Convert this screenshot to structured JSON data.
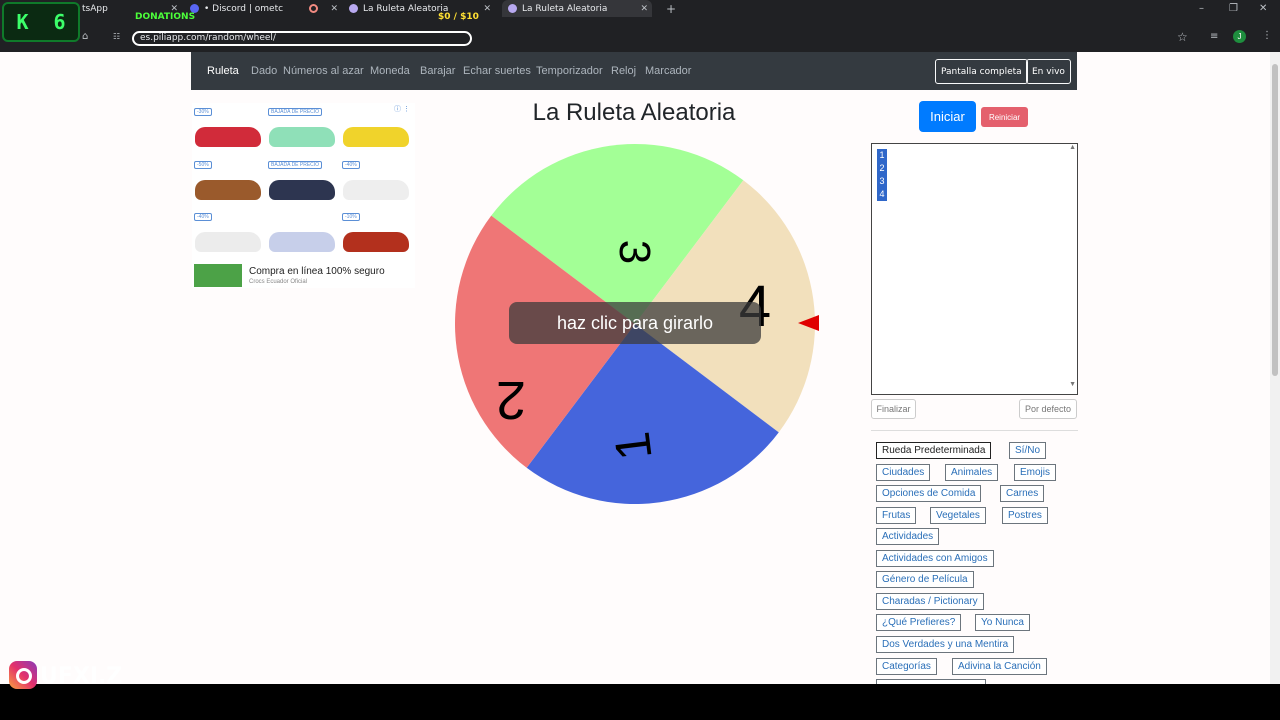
{
  "browser": {
    "tabs": [
      {
        "label": "tsApp"
      },
      {
        "label": "• Discord | ometc"
      },
      {
        "label": "La Ruleta Aleatoria"
      },
      {
        "label": "La Ruleta Aleatoria"
      }
    ],
    "url": "es.piliapp.com/random/wheel/",
    "new_tab": "+",
    "window_controls": [
      "–",
      "❐",
      "✕"
    ]
  },
  "stream_overlay": {
    "counter_letter": "K",
    "counter_value": "6",
    "donations_label": "DONATIONS",
    "money": "$0 / $10",
    "handle": "UFXI.Z"
  },
  "nav": {
    "items": [
      "Ruleta",
      "Dado",
      "Números al azar",
      "Moneda",
      "Barajar",
      "Echar suertes",
      "Temporizador",
      "Reloj",
      "Marcador"
    ],
    "fullscreen": "Pantalla completa",
    "live": "En vivo"
  },
  "ad": {
    "tags": [
      "-30%",
      "BAJADA DE PRECIO",
      "",
      "-50%",
      "BAJADA DE PRECIO",
      "-40%",
      "-40%",
      "",
      "-10%"
    ],
    "text": "Compra en línea 100% seguro",
    "sub": "Crocs Ecuador Oficial"
  },
  "title": "La Ruleta Aleatoria",
  "wheel": {
    "segments": [
      {
        "label": "3",
        "color": "#a3ff96"
      },
      {
        "label": "4",
        "color": "#f2e0bc"
      },
      {
        "label": "1",
        "color": "#4565dc"
      },
      {
        "label": "2",
        "color": "#ef7676"
      }
    ],
    "overlay": "haz clic para girarlo",
    "pointer_color": "#e00000"
  },
  "controls": {
    "start": "Iniciar",
    "reset": "Reiniciar",
    "entries": [
      "1",
      "2",
      "3",
      "4"
    ],
    "finish": "Finalizar",
    "default": "Por defecto"
  },
  "presets": [
    "Rueda Predeterminada",
    "Sí/No",
    "Ciudades",
    "Animales",
    "Emojis",
    "Opciones de Comida",
    "Carnes",
    "Frutas",
    "Vegetales",
    "Postres",
    "Actividades",
    "Actividades con Amigos",
    "Género de Película",
    "Charadas / Pictionary",
    "¿Qué Prefieres?",
    "Yo Nunca",
    "Dos Verdades y una Mentira",
    "Categorías",
    "Adivina la Canción"
  ]
}
